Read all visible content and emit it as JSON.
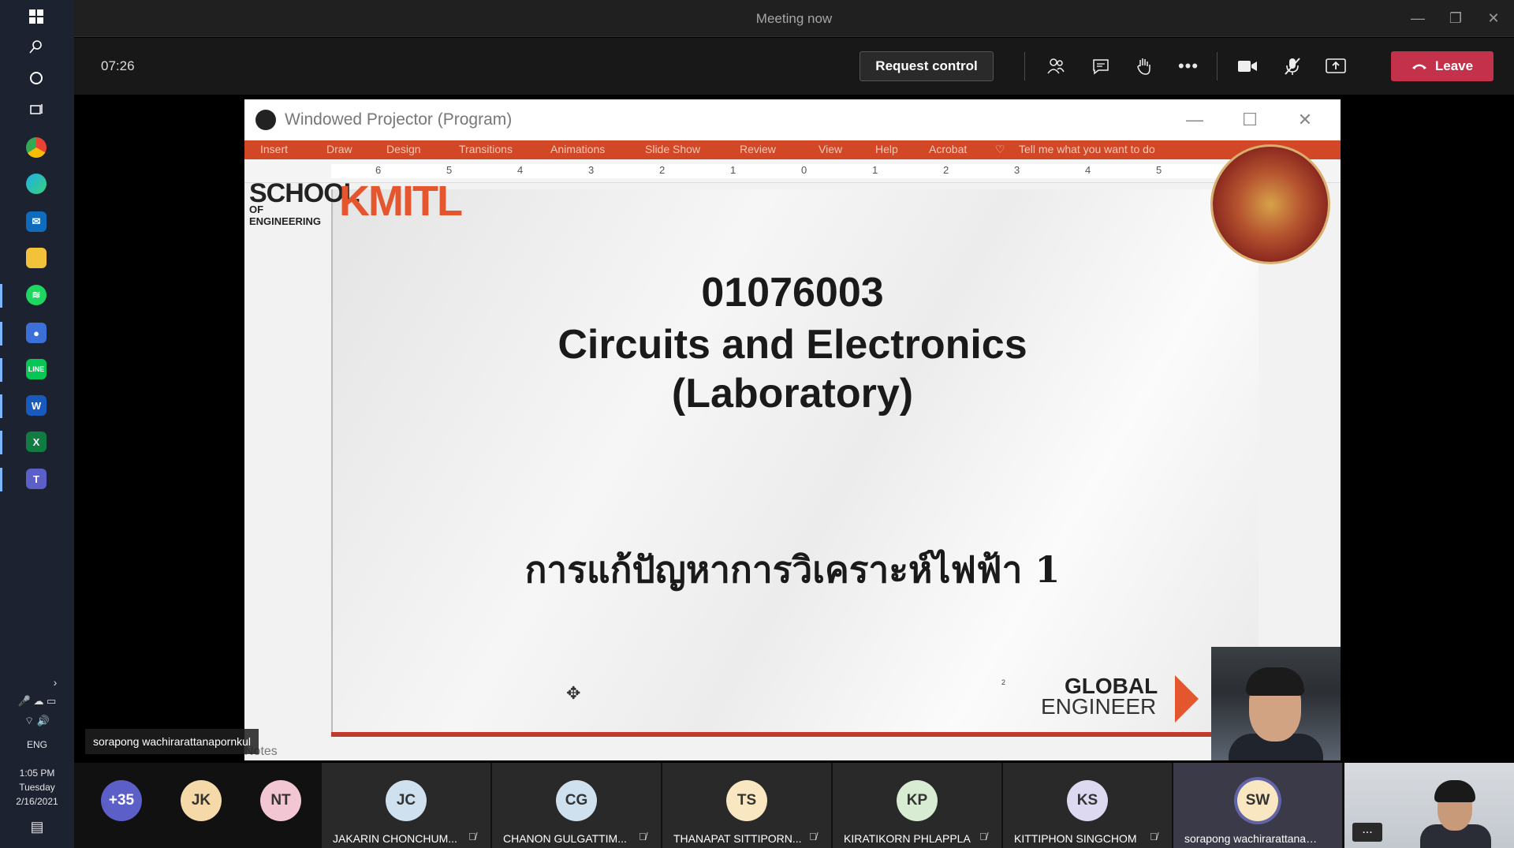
{
  "taskbar": {
    "tray": {
      "language": "ENG",
      "time": "1:05 PM",
      "day": "Tuesday",
      "date": "2/16/2021"
    }
  },
  "window": {
    "title": "Meeting now"
  },
  "controls": {
    "timer": "07:26",
    "request_control_label": "Request control",
    "leave_label": "Leave",
    "leave_color": "#c4314b"
  },
  "projector": {
    "title": "Windowed Projector (Program)",
    "ribbon_tabs": [
      "Insert",
      "Draw",
      "Design",
      "Transitions",
      "Animations",
      "Slide Show",
      "Review",
      "View",
      "Help",
      "Acrobat"
    ],
    "ribbon_search": "Tell me what you want to do",
    "ruler_numbers": [
      "6",
      "5",
      "4",
      "3",
      "2",
      "1",
      "0",
      "1",
      "2",
      "3",
      "4",
      "5"
    ],
    "notes_label": "Notes"
  },
  "slide": {
    "logo_school": "SCHOOL",
    "logo_engineering": "OF ENGINEERING",
    "logo_kmitl": "KMITL",
    "course_code": "01076003",
    "title_line1": "Circuits and Electronics",
    "title_line2": "(Laboratory)",
    "thai_subtitle": "การแก้ปัญหาการวิเคราะห์ไฟฟ้า 1",
    "page_number": "2",
    "global_line1": "GLOBAL",
    "global_line2": "ENGINEER"
  },
  "presenter": {
    "name": "sorapong wachirarattanapornkul"
  },
  "participants": {
    "overflow": [
      {
        "initials": "+35",
        "color": "#5b5fc7",
        "text_color": "#ffffff"
      },
      {
        "initials": "JK",
        "color": "#f5d9a8",
        "text_color": "#333333"
      },
      {
        "initials": "NT",
        "color": "#f3c6d4",
        "text_color": "#333333"
      }
    ],
    "tiles": [
      {
        "initials": "JC",
        "name": "JAKARIN CHONCHUM...",
        "color": "#cfe1ee"
      },
      {
        "initials": "CG",
        "name": "CHANON GULGATTIM...",
        "color": "#cfe1ee"
      },
      {
        "initials": "TS",
        "name": "THANAPAT SITTIPORN...",
        "color": "#f8e7c1"
      },
      {
        "initials": "KP",
        "name": "KIRATIKORN PHLAPPLA",
        "color": "#d7ecd3"
      },
      {
        "initials": "KS",
        "name": "KITTIPHON SINGCHOM",
        "color": "#dcd9f0"
      },
      {
        "initials": "SW",
        "name": "sorapong wachirarattanap...",
        "color": "#f8e7c1"
      }
    ],
    "more_label": "..."
  }
}
